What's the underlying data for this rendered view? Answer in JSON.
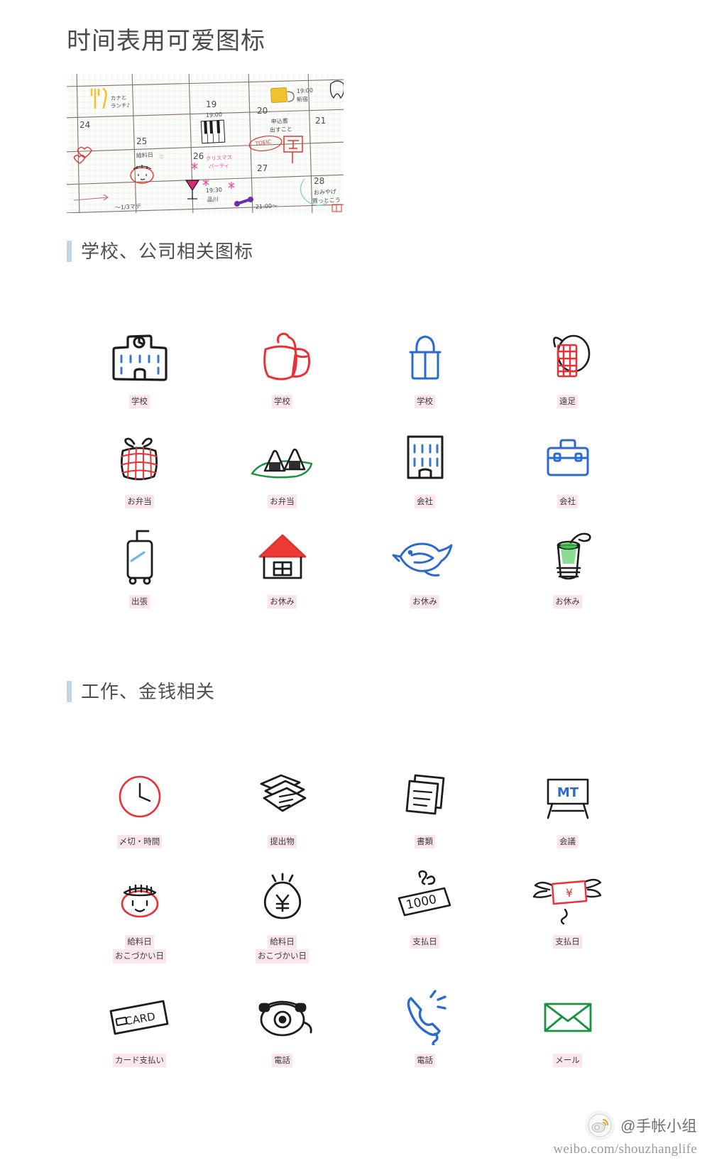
{
  "page": {
    "title": "时间表用可爱图标"
  },
  "calendar_photo": {
    "alt_name": "handwritten-planner-photo",
    "day_numbers": [
      "24",
      "25",
      "19",
      "26",
      "27",
      "20",
      "21",
      "28"
    ],
    "notes": [
      "カナと",
      "ランチ♪",
      "19:00",
      "給料日 ♡",
      "クリスマス",
      "パーティ",
      "19:30",
      "品川",
      "21:00〜",
      "19:00",
      "新宿",
      "申込書",
      "出すこと",
      "TOEIC",
      "〒",
      "おみやげ",
      "買っとこう",
      "〜1/3マデ"
    ]
  },
  "sections": [
    {
      "id": "school-company",
      "title": "学校、公司相关图标",
      "items": [
        {
          "icon": "school-building-icon",
          "labels": [
            "学校"
          ]
        },
        {
          "icon": "school-backpack-icon",
          "labels": [
            "学校"
          ]
        },
        {
          "icon": "school-bag-icon",
          "labels": [
            "学校"
          ]
        },
        {
          "icon": "water-bottle-icon",
          "labels": [
            "遠足"
          ]
        },
        {
          "icon": "bento-wrapped-icon",
          "labels": [
            "お弁当"
          ]
        },
        {
          "icon": "onigiri-icon",
          "labels": [
            "お弁当"
          ]
        },
        {
          "icon": "office-building-icon",
          "labels": [
            "会社"
          ]
        },
        {
          "icon": "briefcase-icon",
          "labels": [
            "会社"
          ]
        },
        {
          "icon": "suitcase-icon",
          "labels": [
            "出張"
          ]
        },
        {
          "icon": "house-icon",
          "labels": [
            "お休み"
          ]
        },
        {
          "icon": "bird-icon",
          "labels": [
            "お休み"
          ]
        },
        {
          "icon": "melon-soda-icon",
          "labels": [
            "お休み"
          ]
        }
      ]
    },
    {
      "id": "work-money",
      "title": "工作、金钱相关",
      "items": [
        {
          "icon": "clock-icon",
          "labels": [
            "〆切・時間"
          ]
        },
        {
          "icon": "documents-stack-icon",
          "labels": [
            "提出物"
          ]
        },
        {
          "icon": "paper-sheets-icon",
          "labels": [
            "書類"
          ]
        },
        {
          "icon": "meeting-board-icon",
          "labels": [
            "会議"
          ]
        },
        {
          "icon": "coin-purse-icon",
          "labels": [
            "給料日",
            "おこづかい日"
          ]
        },
        {
          "icon": "money-bag-icon",
          "labels": [
            "給料日",
            "おこづかい日"
          ]
        },
        {
          "icon": "banknote-icon",
          "labels": [
            "支払日"
          ]
        },
        {
          "icon": "flying-money-icon",
          "labels": [
            "支払日"
          ]
        },
        {
          "icon": "credit-card-icon",
          "labels": [
            "カード支払い"
          ]
        },
        {
          "icon": "telephone-icon",
          "labels": [
            "電話"
          ]
        },
        {
          "icon": "phone-handset-icon",
          "labels": [
            "電話"
          ]
        },
        {
          "icon": "envelope-icon",
          "labels": [
            "メール"
          ]
        }
      ]
    }
  ],
  "watermark": {
    "account": "@手帐小组",
    "url": "weibo.com/shouzhanglife"
  },
  "colors": {
    "accent_bar": "#c3d6e6",
    "caption_bg": "#fbe6ec",
    "title_text": "#4a4a4a",
    "red": "#e8322d",
    "blue": "#2f6fd0",
    "green": "#1f9c3d",
    "ink": "#1a1a1a",
    "yellow": "#f2c12e",
    "purple": "#6b2fa8",
    "pink": "#ef4d9a"
  }
}
